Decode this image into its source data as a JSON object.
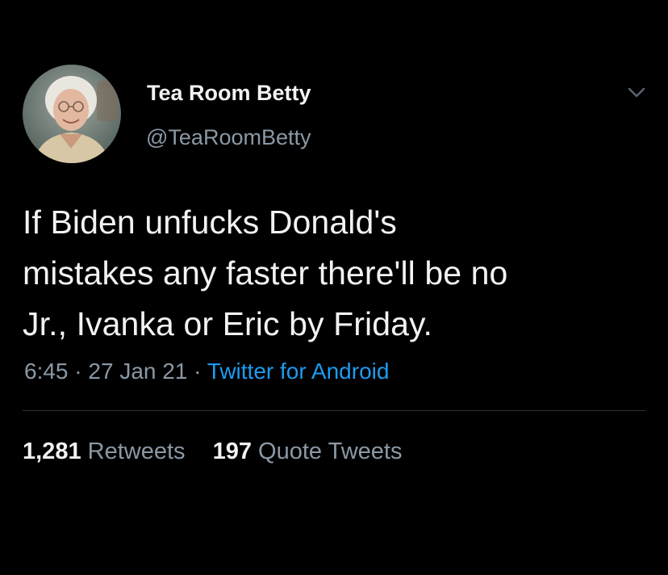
{
  "author": {
    "display_name": "Tea Room Betty",
    "handle": "@TeaRoomBetty",
    "avatar_icon": "elderly-woman-avatar"
  },
  "tweet": {
    "text_lines": [
      "If Biden unfucks Donald's",
      "mistakes any faster there'll be no",
      "Jr., Ivanka or Eric by Friday."
    ],
    "time": "6:45",
    "separator": "·",
    "date": "27 Jan 21",
    "source": "Twitter for Android"
  },
  "stats": {
    "retweets": {
      "count": "1,281",
      "label": "Retweets"
    },
    "quote_tweets": {
      "count": "197",
      "label": "Quote Tweets"
    }
  },
  "colors": {
    "background": "#000000",
    "primary_text": "#f2f2f2",
    "secondary_text": "#8b98a5",
    "link": "#1d9bf0",
    "divider": "#2f3336"
  },
  "icons": {
    "menu": "chevron-down-icon"
  }
}
